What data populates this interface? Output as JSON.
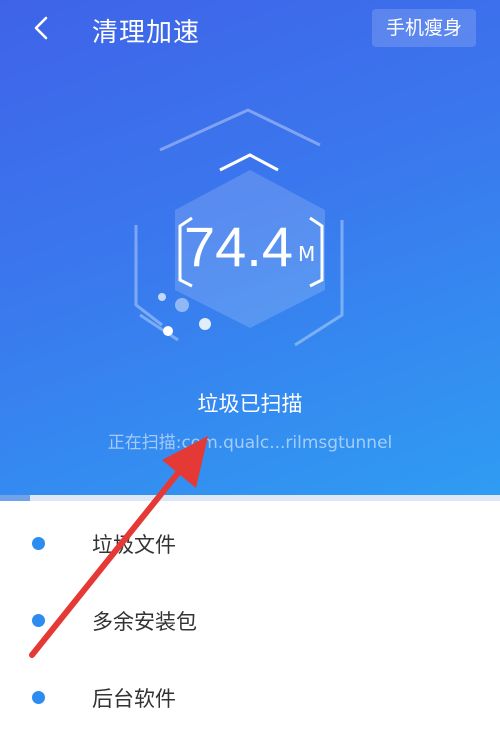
{
  "header": {
    "back_icon": "chevron-left-icon",
    "title": "清理加速",
    "slim_button": "手机瘦身"
  },
  "scan": {
    "size_value": "74.4",
    "size_unit": "M",
    "status": "垃圾已扫描",
    "scanning_text": "正在扫描:com.qualc...rilmsgtunnel",
    "progress": 0.06
  },
  "categories": [
    {
      "label": "垃圾文件"
    },
    {
      "label": "多余安装包"
    },
    {
      "label": "后台软件"
    }
  ],
  "annotation": {
    "arrow_color": "#e53935"
  },
  "colors": {
    "hero_top": "#3f63e8",
    "hero_bottom": "#2f9cf2",
    "bullet": "#2d8cf0"
  }
}
